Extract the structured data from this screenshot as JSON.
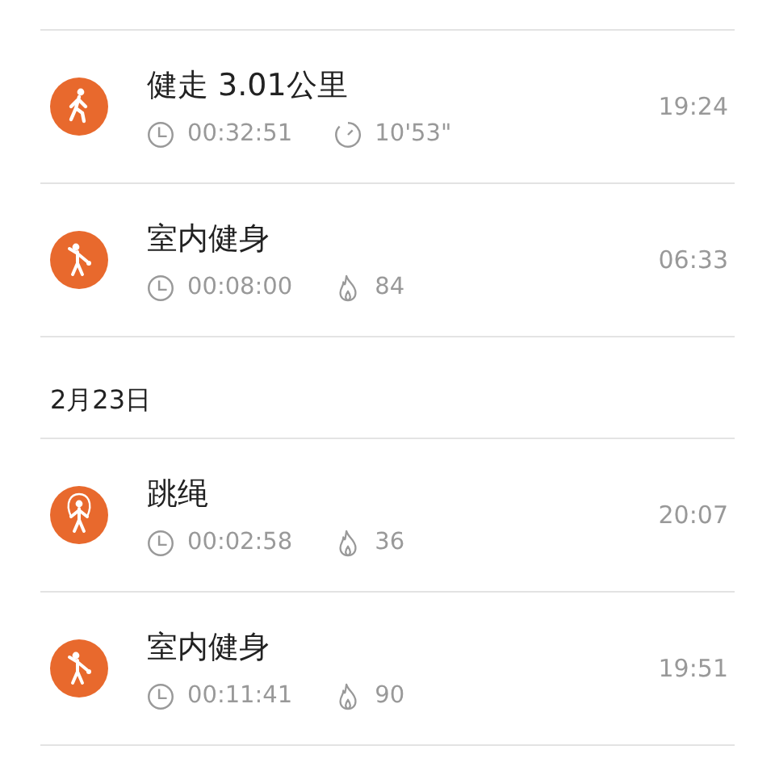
{
  "groups": [
    {
      "items": [
        {
          "kind": "walk",
          "title": "健走 3.01公里",
          "stats": [
            {
              "kind": "duration",
              "value": "00:32:51"
            },
            {
              "kind": "pace",
              "value": "10'53\""
            }
          ],
          "time": "19:24"
        },
        {
          "kind": "fitness",
          "title": "室内健身",
          "stats": [
            {
              "kind": "duration",
              "value": "00:08:00"
            },
            {
              "kind": "calories",
              "value": "84"
            }
          ],
          "time": "06:33"
        }
      ]
    },
    {
      "date": "2月23日",
      "items": [
        {
          "kind": "jumprope",
          "title": "跳绳",
          "stats": [
            {
              "kind": "duration",
              "value": "00:02:58"
            },
            {
              "kind": "calories",
              "value": "36"
            }
          ],
          "time": "20:07"
        },
        {
          "kind": "fitness",
          "title": "室内健身",
          "stats": [
            {
              "kind": "duration",
              "value": "00:11:41"
            },
            {
              "kind": "calories",
              "value": "90"
            }
          ],
          "time": "19:51"
        }
      ]
    }
  ]
}
